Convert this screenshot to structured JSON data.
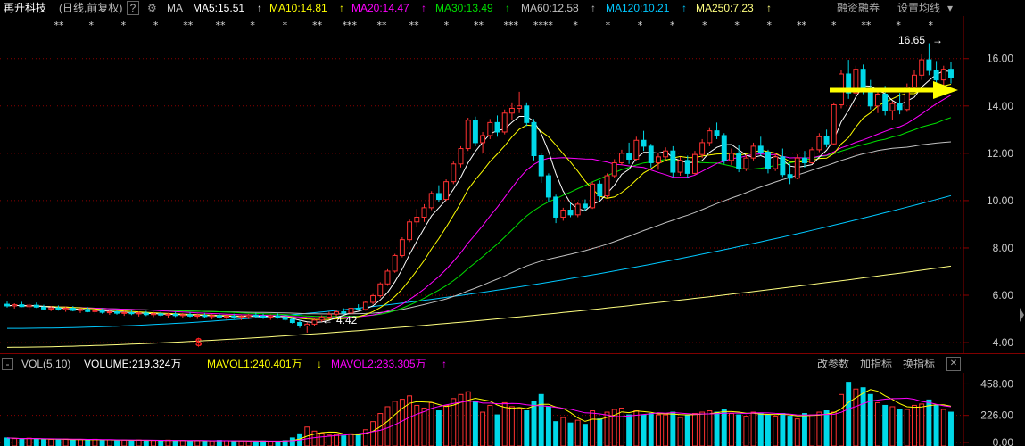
{
  "header": {
    "stock_name": "再升科技",
    "period": "(日线,前复权)",
    "help": "?",
    "settings_glyph": "⚙",
    "ma_label": "MA",
    "ma5": "MA5:15.51",
    "ma10": "MA10:14.81",
    "ma20": "MA20:14.47",
    "ma30": "MA30:13.49",
    "ma60": "MA60:12.58",
    "ma120": "MA120:10.21",
    "ma250": "MA250:7.23",
    "up_arrow": "↑",
    "margin_trading": "融资融券",
    "set_ma": "设置均线",
    "dropdown": "▾"
  },
  "volume_header": {
    "toggle": "-",
    "vol": "VOL(5,10)",
    "volume": "VOLUME:219.324万",
    "mavol1": "MAVOL1:240.401万",
    "mavol1_arrow": "↓",
    "mavol2": "MAVOL2:233.305万",
    "mavol2_arrow": "↑",
    "edit_params": "改参数",
    "add_indicator": "加指标",
    "switch_indicator": "换指标",
    "close": "✕"
  },
  "colors": {
    "up": "#ff3232",
    "down": "#00d8e8",
    "ma5": "#ffffff",
    "ma10": "#ffff00",
    "ma20": "#ff00ff",
    "ma30": "#00e000",
    "ma60": "#c0c0c0",
    "ma120": "#00c8ff",
    "ma250": "#ffff80",
    "arrow": "#ffff00",
    "grid": "#8b0000"
  },
  "chart_data": [
    {
      "type": "candlestick",
      "title": "再升科技 (日线,前复权)",
      "y_ticks": [
        "16.00",
        "14.00",
        "12.00",
        "10.00",
        "8.00",
        "6.00",
        "4.00"
      ],
      "ylim": [
        3.55,
        17.8
      ],
      "annotations": {
        "high": "16.65",
        "low": "4.42",
        "high_arrow": "→",
        "low_arrow": "←",
        "marker": "$"
      },
      "event_markers": [
        "**",
        "*",
        "*",
        "*",
        "**",
        "**",
        "*",
        "*",
        "**",
        "***",
        "**",
        "**",
        "*",
        "**",
        "***",
        "****",
        "*",
        "*",
        "*",
        "*",
        "*",
        "*",
        "*",
        "**",
        "*",
        "**",
        "*",
        "*"
      ],
      "moving_averages_latest": {
        "MA5": 15.51,
        "MA10": 14.81,
        "MA20": 14.47,
        "MA30": 13.49,
        "MA60": 12.58,
        "MA120": 10.21,
        "MA250": 7.23
      },
      "ohlc": [
        [
          5.62,
          5.73,
          5.48,
          5.55
        ],
        [
          5.55,
          5.66,
          5.44,
          5.6
        ],
        [
          5.6,
          5.72,
          5.5,
          5.52
        ],
        [
          5.52,
          5.65,
          5.4,
          5.58
        ],
        [
          5.58,
          5.69,
          5.46,
          5.5
        ],
        [
          5.5,
          5.6,
          5.36,
          5.42
        ],
        [
          5.42,
          5.55,
          5.33,
          5.47
        ],
        [
          5.47,
          5.57,
          5.35,
          5.4
        ],
        [
          5.4,
          5.52,
          5.3,
          5.45
        ],
        [
          5.45,
          5.54,
          5.32,
          5.36
        ],
        [
          5.36,
          5.47,
          5.25,
          5.4
        ],
        [
          5.4,
          5.5,
          5.28,
          5.31
        ],
        [
          5.31,
          5.42,
          5.2,
          5.35
        ],
        [
          5.35,
          5.45,
          5.22,
          5.28
        ],
        [
          5.28,
          5.38,
          5.17,
          5.3
        ],
        [
          5.3,
          5.4,
          5.18,
          5.24
        ],
        [
          5.24,
          5.35,
          5.13,
          5.27
        ],
        [
          5.27,
          5.37,
          5.16,
          5.22
        ],
        [
          5.22,
          5.32,
          5.1,
          5.25
        ],
        [
          5.25,
          5.34,
          5.12,
          5.18
        ],
        [
          5.18,
          5.3,
          5.08,
          5.22
        ],
        [
          5.22,
          5.31,
          5.1,
          5.16
        ],
        [
          5.16,
          5.26,
          5.05,
          5.2
        ],
        [
          5.2,
          5.3,
          5.08,
          5.14
        ],
        [
          5.14,
          5.25,
          5.04,
          5.18
        ],
        [
          5.18,
          5.28,
          5.07,
          5.12
        ],
        [
          5.12,
          5.22,
          5.0,
          5.15
        ],
        [
          5.15,
          5.25,
          5.03,
          5.1
        ],
        [
          5.1,
          5.2,
          4.98,
          5.14
        ],
        [
          5.14,
          5.23,
          5.01,
          5.08
        ],
        [
          5.08,
          5.19,
          4.96,
          5.12
        ],
        [
          5.12,
          5.22,
          5.0,
          5.06
        ],
        [
          5.06,
          5.17,
          4.95,
          5.1
        ],
        [
          5.1,
          5.21,
          4.99,
          5.16
        ],
        [
          5.16,
          5.26,
          5.04,
          5.12
        ],
        [
          5.12,
          5.22,
          5.0,
          5.08
        ],
        [
          5.08,
          5.18,
          4.96,
          5.13
        ],
        [
          5.13,
          5.23,
          5.01,
          5.07
        ],
        [
          5.07,
          5.16,
          4.92,
          4.98
        ],
        [
          4.98,
          5.08,
          4.8,
          4.85
        ],
        [
          4.85,
          4.95,
          4.62,
          4.7
        ],
        [
          4.7,
          4.85,
          4.42,
          4.78
        ],
        [
          4.78,
          5.02,
          4.7,
          4.95
        ],
        [
          4.95,
          5.15,
          4.88,
          5.08
        ],
        [
          5.08,
          5.3,
          5.0,
          5.2
        ],
        [
          5.2,
          5.38,
          5.1,
          5.3
        ],
        [
          5.3,
          5.45,
          5.18,
          5.25
        ],
        [
          5.25,
          5.5,
          5.2,
          5.45
        ],
        [
          5.45,
          5.62,
          5.35,
          5.4
        ],
        [
          5.4,
          5.75,
          5.35,
          5.7
        ],
        [
          5.7,
          6.05,
          5.62,
          5.98
        ],
        [
          5.98,
          6.55,
          5.9,
          6.48
        ],
        [
          6.48,
          7.1,
          6.4,
          7.02
        ],
        [
          7.02,
          7.75,
          6.95,
          7.68
        ],
        [
          7.68,
          8.45,
          7.6,
          8.35
        ],
        [
          8.35,
          9.2,
          8.25,
          9.1
        ],
        [
          9.1,
          9.65,
          8.9,
          9.3
        ],
        [
          9.3,
          9.85,
          9.1,
          9.7
        ],
        [
          9.7,
          10.4,
          9.6,
          10.3
        ],
        [
          10.3,
          10.65,
          9.95,
          10.05
        ],
        [
          10.05,
          10.9,
          10.0,
          10.8
        ],
        [
          10.8,
          11.65,
          10.7,
          11.55
        ],
        [
          11.55,
          12.3,
          11.4,
          12.2
        ],
        [
          12.2,
          13.5,
          12.1,
          13.4
        ],
        [
          13.4,
          13.55,
          12.3,
          12.45
        ],
        [
          12.45,
          12.9,
          12.0,
          12.75
        ],
        [
          12.75,
          13.45,
          12.6,
          13.3
        ],
        [
          13.3,
          13.6,
          12.7,
          12.9
        ],
        [
          12.9,
          13.85,
          12.8,
          13.7
        ],
        [
          13.7,
          14.15,
          13.4,
          13.9
        ],
        [
          13.9,
          14.6,
          13.7,
          14.0
        ],
        [
          14.0,
          14.15,
          13.15,
          13.3
        ],
        [
          13.3,
          13.45,
          11.7,
          11.9
        ],
        [
          11.9,
          12.0,
          10.75,
          11.05
        ],
        [
          11.05,
          11.15,
          9.95,
          10.15
        ],
        [
          10.15,
          10.25,
          9.05,
          9.3
        ],
        [
          9.3,
          9.7,
          9.15,
          9.6
        ],
        [
          9.6,
          9.9,
          9.3,
          9.4
        ],
        [
          9.4,
          9.95,
          9.3,
          9.85
        ],
        [
          9.85,
          10.05,
          9.55,
          9.7
        ],
        [
          9.7,
          10.8,
          9.65,
          10.7
        ],
        [
          10.7,
          10.85,
          10.0,
          10.2
        ],
        [
          10.2,
          11.15,
          10.1,
          11.05
        ],
        [
          11.05,
          11.75,
          10.95,
          11.6
        ],
        [
          11.6,
          12.15,
          11.5,
          12.0
        ],
        [
          12.0,
          12.45,
          11.55,
          11.75
        ],
        [
          11.75,
          12.7,
          11.7,
          12.55
        ],
        [
          12.55,
          12.95,
          12.1,
          12.3
        ],
        [
          12.3,
          12.4,
          11.4,
          11.6
        ],
        [
          11.6,
          12.0,
          11.3,
          11.85
        ],
        [
          11.85,
          12.25,
          11.7,
          12.1
        ],
        [
          12.1,
          12.3,
          11.0,
          11.2
        ],
        [
          11.2,
          11.85,
          11.05,
          11.7
        ],
        [
          11.7,
          11.9,
          10.95,
          11.15
        ],
        [
          11.15,
          12.1,
          11.1,
          11.95
        ],
        [
          11.95,
          12.6,
          11.8,
          12.45
        ],
        [
          12.45,
          13.1,
          12.3,
          12.95
        ],
        [
          12.95,
          13.3,
          12.6,
          12.75
        ],
        [
          12.75,
          12.85,
          11.55,
          11.7
        ],
        [
          11.7,
          12.2,
          11.5,
          12.0
        ],
        [
          12.0,
          12.35,
          11.2,
          11.35
        ],
        [
          11.35,
          11.95,
          11.25,
          11.8
        ],
        [
          11.8,
          12.45,
          11.7,
          12.3
        ],
        [
          12.3,
          12.7,
          11.9,
          12.05
        ],
        [
          12.05,
          12.15,
          11.15,
          11.35
        ],
        [
          11.35,
          12.0,
          11.25,
          11.85
        ],
        [
          11.85,
          12.2,
          11.0,
          11.1
        ],
        [
          11.1,
          11.55,
          10.7,
          10.95
        ],
        [
          10.95,
          11.95,
          10.9,
          11.8
        ],
        [
          11.8,
          12.1,
          11.4,
          11.6
        ],
        [
          11.6,
          12.25,
          11.55,
          12.15
        ],
        [
          12.15,
          12.85,
          12.05,
          12.7
        ],
        [
          12.7,
          13.0,
          12.25,
          12.4
        ],
        [
          12.4,
          14.15,
          12.35,
          14.05
        ],
        [
          14.05,
          15.5,
          13.9,
          15.35
        ],
        [
          15.35,
          15.95,
          14.3,
          14.55
        ],
        [
          14.55,
          15.7,
          14.4,
          15.55
        ],
        [
          15.55,
          15.75,
          14.5,
          14.75
        ],
        [
          14.75,
          15.1,
          13.85,
          14.0
        ],
        [
          14.0,
          14.65,
          13.7,
          14.5
        ],
        [
          14.5,
          14.85,
          13.6,
          13.8
        ],
        [
          13.8,
          14.2,
          13.4,
          14.1
        ],
        [
          14.1,
          14.55,
          13.65,
          13.85
        ],
        [
          13.85,
          14.95,
          13.75,
          14.8
        ],
        [
          14.8,
          15.5,
          14.6,
          15.3
        ],
        [
          15.3,
          16.2,
          15.1,
          15.95
        ],
        [
          15.95,
          16.65,
          15.3,
          15.5
        ],
        [
          15.5,
          15.9,
          14.9,
          15.1
        ],
        [
          15.1,
          15.7,
          14.85,
          15.55
        ],
        [
          15.55,
          15.85,
          14.95,
          15.2
        ]
      ]
    },
    {
      "type": "bar",
      "title": "VOL(5,10)",
      "unit": "万",
      "y_ticks": [
        "458.00",
        "226.00",
        "0.00"
      ],
      "ylim": [
        0,
        540
      ],
      "values": [
        60,
        55,
        50,
        58,
        52,
        48,
        50,
        46,
        52,
        45,
        48,
        44,
        50,
        42,
        46,
        40,
        44,
        42,
        45,
        40,
        42,
        38,
        44,
        40,
        42,
        38,
        40,
        36,
        38,
        42,
        40,
        36,
        38,
        34,
        36,
        38,
        34,
        36,
        40,
        60,
        90,
        140,
        110,
        95,
        80,
        85,
        75,
        90,
        85,
        120,
        180,
        240,
        290,
        330,
        345,
        370,
        300,
        280,
        320,
        260,
        300,
        350,
        380,
        400,
        330,
        250,
        300,
        230,
        320,
        290,
        280,
        260,
        330,
        380,
        290,
        180,
        210,
        170,
        190,
        160,
        260,
        200,
        250,
        270,
        280,
        230,
        260,
        230,
        240,
        230,
        230,
        250,
        210,
        230,
        240,
        250,
        260,
        250,
        270,
        240,
        230,
        220,
        250,
        240,
        230,
        220,
        240,
        220,
        200,
        240,
        230,
        250,
        260,
        250,
        380,
        470,
        420,
        430,
        380,
        320,
        300,
        290,
        270,
        270,
        300,
        310,
        340,
        300,
        270,
        250
      ]
    }
  ]
}
